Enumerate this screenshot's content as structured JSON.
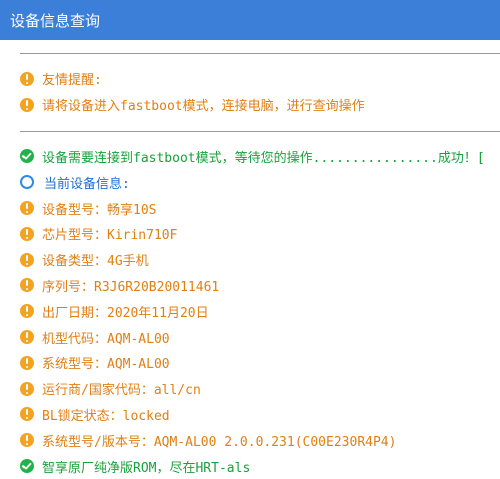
{
  "window": {
    "title": "设备信息查询"
  },
  "log": {
    "divider_1": "",
    "tip_title": "友情提醒:",
    "tip_text": "请将设备进入fastboot模式，连接电脑，进行查询操作",
    "divider_2": "",
    "connect_status": "设备需要连接到fastboot模式，等待您的操作................成功！[",
    "current_info": "当前设备信息:",
    "device_model": "设备型号：畅享10S",
    "chip_model": "芯片型号：Kirin710F",
    "device_type": "设备类型：4G手机",
    "serial": "序列号：R3J6R20B20011461",
    "manufacture_date": "出厂日期：2020年11月20日",
    "model_code": "机型代码：AQM-AL00",
    "system_model": "系统型号：AQM-AL00",
    "carrier": "运行商/国家代码：all/cn",
    "bl_lock": "BL锁定状态：locked",
    "system_version": "系统型号/版本号：AQM-AL00 2.0.0.231(C00E230R4P4)",
    "rom_note": "智享原厂纯净版ROM，尽在HRT-als"
  },
  "colors": {
    "titlebar": "#3b7fd8",
    "warn": "#f2a322",
    "ok": "#21b34a",
    "info": "#2d8ce0",
    "orange_text": "#e07f15",
    "green_text": "#18a23d",
    "blue_text": "#1f6ed4"
  },
  "icons": {
    "warn": "exclamation-circle-icon",
    "ok": "check-circle-icon",
    "info": "info-ring-icon"
  }
}
